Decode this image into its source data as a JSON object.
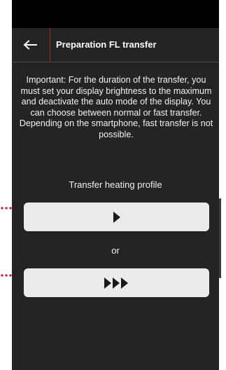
{
  "header": {
    "title": "Preparation FL transfer"
  },
  "info": {
    "text": "Important: For the duration of the transfer, you must set your display brightness to the maximum and deactivate the auto mode of the display. You can choose between normal or fast transfer. Depending on the smartphone, fast transfer is not possible."
  },
  "transfer": {
    "label": "Transfer heating profile",
    "or_label": "or"
  },
  "icons": {
    "back": "arrow-left-icon",
    "normal": "play-icon",
    "fast": "fast-forward-icon"
  },
  "colors": {
    "background": "#242424",
    "status_bar": "#000000",
    "accent_divider": "#9b2a2a",
    "button": "#ebebeb",
    "callout": "#c8102e"
  }
}
